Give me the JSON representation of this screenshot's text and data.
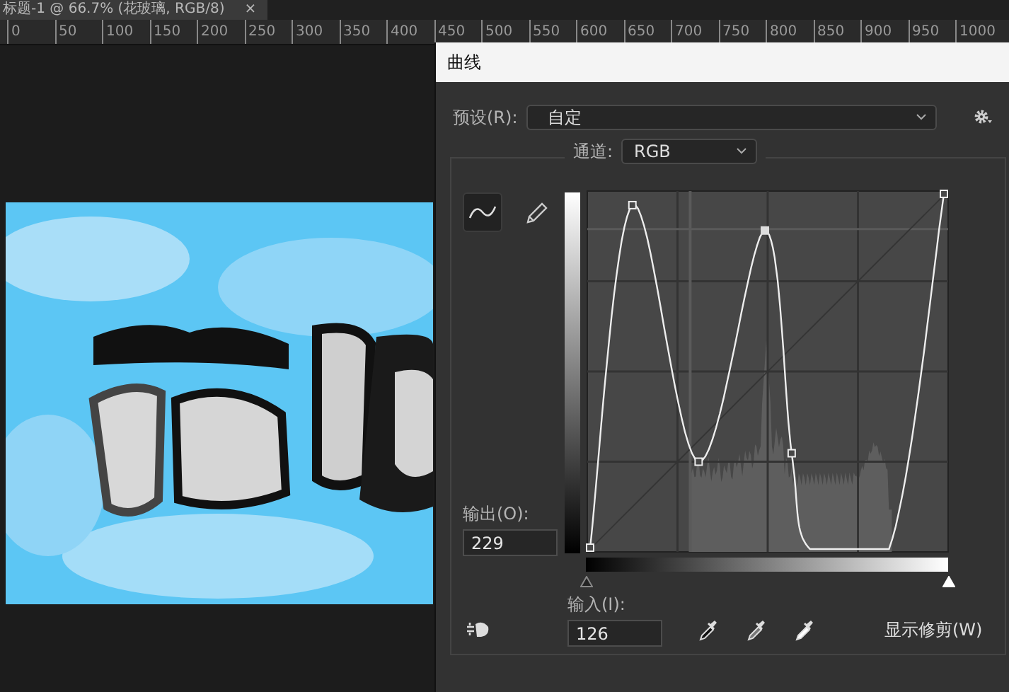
{
  "document_tab": {
    "title": "标题-1 @ 66.7% (花玻璃, RGB/8)",
    "close": "×"
  },
  "ruler": {
    "ticks": [
      "0",
      "50",
      "100",
      "150",
      "200",
      "250",
      "300",
      "350",
      "400",
      "450",
      "500",
      "550",
      "600",
      "650",
      "700",
      "750",
      "800",
      "850",
      "900",
      "950",
      "1000"
    ]
  },
  "dialog": {
    "title": "曲线",
    "preset": {
      "label": "预设(R):",
      "value": "自定"
    },
    "channel": {
      "label": "通道:",
      "value": "RGB"
    },
    "tools": [
      {
        "kind": "curve",
        "selected": true
      },
      {
        "kind": "pencil",
        "selected": false
      }
    ],
    "output": {
      "label": "输出(O):",
      "value": "229"
    },
    "input": {
      "label": "输入(I):",
      "value": "126"
    },
    "input_sliders": [
      {
        "level": 0
      },
      {
        "level": 1
      }
    ],
    "show_clipping": {
      "label": "显示修剪(W)"
    }
  }
}
